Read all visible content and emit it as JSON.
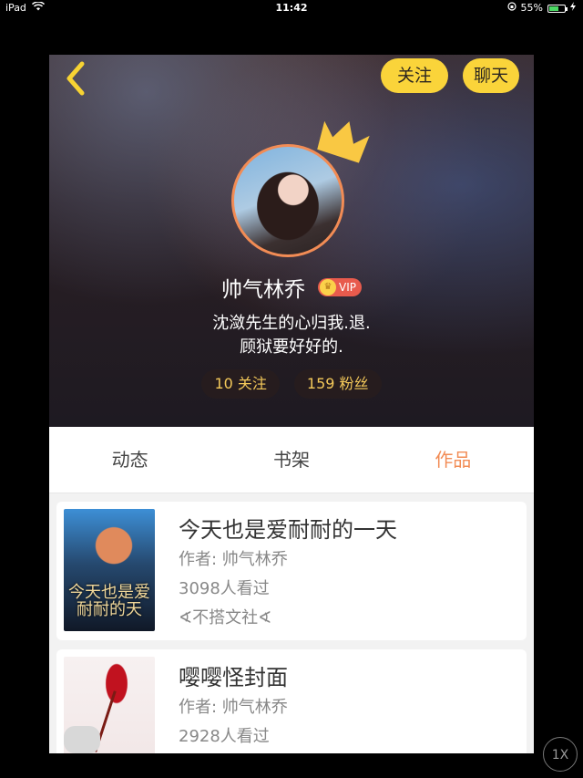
{
  "status_bar": {
    "device": "iPad",
    "time": "11:42",
    "battery": "55%",
    "battery_level": 0.55
  },
  "header": {
    "back_icon": "chevron-left-icon",
    "follow_label": "关注",
    "chat_label": "聊天"
  },
  "profile": {
    "username": "帅气林乔",
    "vip_label": "VIP",
    "bio_line1": "沈潋先生的心归我.退.",
    "bio_line2": "顾狱要好好的.",
    "following": "10 关注",
    "followers": "159 粉丝"
  },
  "tabs": [
    {
      "label": "动态",
      "active": false
    },
    {
      "label": "书架",
      "active": false
    },
    {
      "label": "作品",
      "active": true
    }
  ],
  "works": [
    {
      "title": "今天也是爱耐耐的一天",
      "author": "作者: 帅气林乔",
      "views": "3098人看过",
      "publisher": "∢不搭文社∢",
      "cover_text": "今天也是爱耐耐的天"
    },
    {
      "title": "嘤嘤怪封面",
      "author": "作者: 帅气林乔",
      "views": "2928人看过"
    }
  ],
  "zoom_label": "1X",
  "colors": {
    "accent_yellow": "#fad43a",
    "accent_orange": "#f28c55",
    "vip_red": "#e85b4d"
  }
}
